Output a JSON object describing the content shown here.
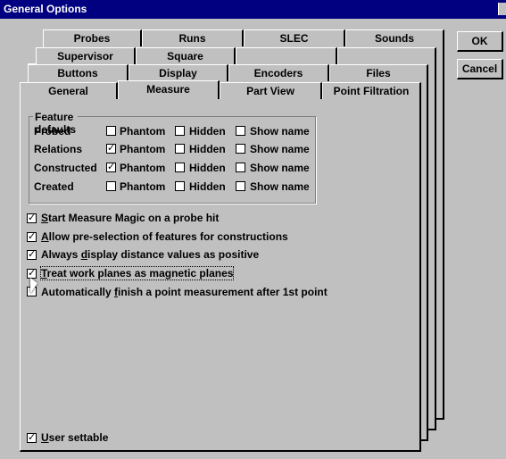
{
  "window": {
    "title": "General Options"
  },
  "buttons": {
    "ok": "OK",
    "cancel": "Cancel"
  },
  "tabs": {
    "row1": [
      "Probes",
      "Runs",
      "SLEC",
      "Sounds"
    ],
    "row2": [
      "Supervisor",
      "Square"
    ],
    "row3": [
      "Buttons",
      "Display",
      "Encoders",
      "Files"
    ],
    "row4": [
      "General",
      "Measure",
      "Part View",
      "Point Filtration"
    ],
    "active": "Measure"
  },
  "feature_defaults": {
    "title": "Feature defaults",
    "columns": [
      "Phantom",
      "Hidden",
      "Show name"
    ],
    "rows": [
      {
        "label": "Probed",
        "phantom": false,
        "hidden": false,
        "show_name": false
      },
      {
        "label": "Relations",
        "phantom": true,
        "hidden": false,
        "show_name": false
      },
      {
        "label": "Constructed",
        "phantom": true,
        "hidden": false,
        "show_name": false
      },
      {
        "label": "Created",
        "phantom": false,
        "hidden": false,
        "show_name": false
      }
    ]
  },
  "options": [
    {
      "pre": "",
      "ul": "S",
      "post": "tart Measure Magic on a probe hit",
      "checked": true
    },
    {
      "pre": "",
      "ul": "A",
      "post": "llow pre-selection of features for constructions",
      "checked": true
    },
    {
      "pre": "Always ",
      "ul": "d",
      "post": "isplay distance values as positive",
      "checked": true
    },
    {
      "pre": "",
      "ul": "T",
      "post": "reat work planes as magnetic planes",
      "checked": true
    },
    {
      "pre": "Automatically ",
      "ul": "f",
      "post": "inish a point measurement after 1st point",
      "checked": false
    }
  ],
  "user_settable": {
    "ul": "U",
    "post": "ser settable",
    "checked": true
  },
  "check_glyph": "✓"
}
